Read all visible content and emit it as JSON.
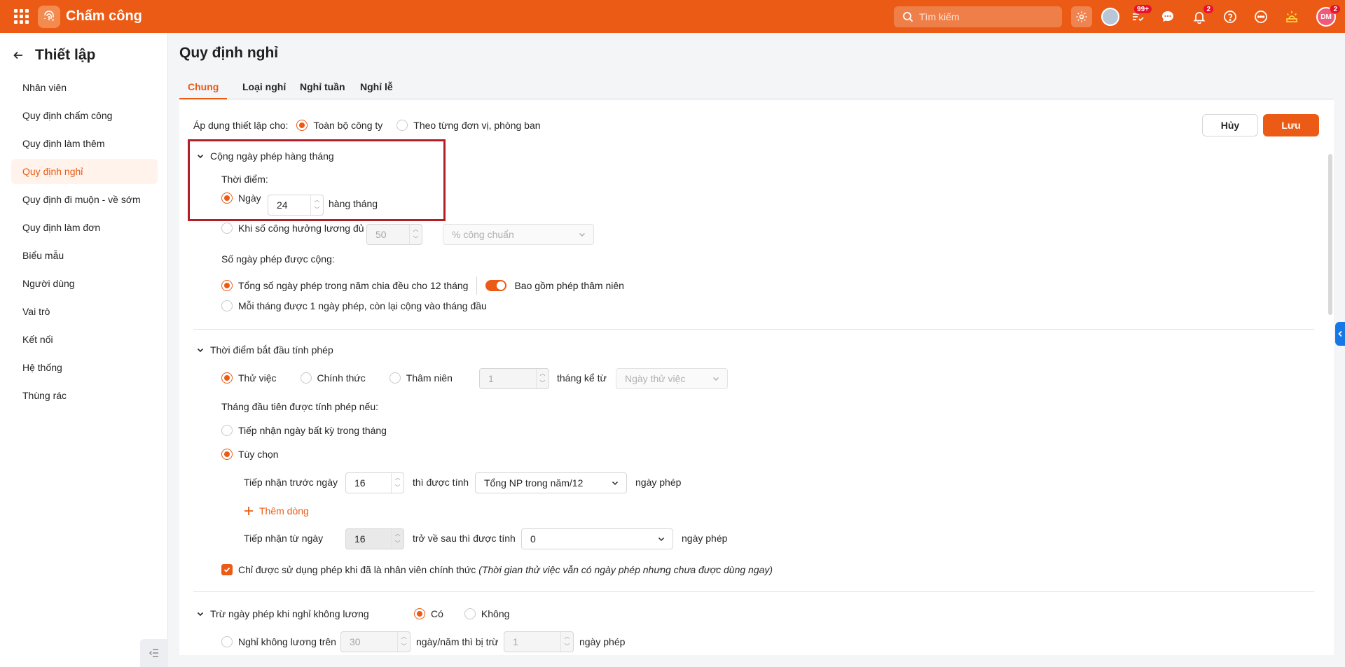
{
  "app": {
    "title": "Chấm công"
  },
  "topbar": {
    "search_placeholder": "Tìm kiếm",
    "icons": [
      "apps-grid-icon",
      "gear-icon",
      "avatar-icon",
      "task-icon",
      "chat-icon",
      "bell-icon",
      "help-icon",
      "more-icon",
      "sun-icon",
      "user-avatar"
    ],
    "task_badge": "99+",
    "bell_badge": "2",
    "user_initials": "DM",
    "user_badge": "2"
  },
  "sidebar": {
    "title": "Thiết lập",
    "items": [
      {
        "label": "Nhân viên"
      },
      {
        "label": "Quy định chấm công"
      },
      {
        "label": "Quy định làm thêm"
      },
      {
        "label": "Quy định nghỉ",
        "active": true
      },
      {
        "label": "Quy định đi muộn - về sớm"
      },
      {
        "label": "Quy định làm đơn"
      },
      {
        "label": "Biểu mẫu"
      },
      {
        "label": "Người dùng"
      },
      {
        "label": "Vai trò"
      },
      {
        "label": "Kết nối"
      },
      {
        "label": "Hệ thống"
      },
      {
        "label": "Thùng rác"
      }
    ]
  },
  "page": {
    "title": "Quy định nghỉ",
    "tabs": [
      {
        "label": "Chung",
        "active": true
      },
      {
        "label": "Loại nghỉ"
      },
      {
        "label": "Nghỉ tuần"
      },
      {
        "label": "Nghỉ lễ"
      }
    ]
  },
  "apply": {
    "label": "Áp dụng thiết lập cho:",
    "opt_company": "Toàn bộ công ty",
    "opt_units": "Theo từng đơn vị, phòng ban",
    "selected": "opt_company"
  },
  "actions": {
    "cancel": "Hủy",
    "save": "Lưu"
  },
  "monthly": {
    "title": "Cộng ngày phép hàng tháng",
    "time_label": "Thời điểm:",
    "day_label": "Ngày",
    "day_value": "24",
    "day_suffix": "hàng tháng",
    "when_label": "Khi số công hưởng lương đủ",
    "when_value": "50",
    "when_unit": "% công chuẩn",
    "count_label": "Số ngày phép được cộng:",
    "count_opt1": "Tổng số ngày phép trong năm chia đều cho 12 tháng",
    "seniority_toggle": "Bao gồm phép thâm niên",
    "count_opt2": "Mỗi tháng được 1 ngày phép, còn lại cộng vào tháng đầu"
  },
  "start": {
    "title": "Thời điểm bắt đầu tính phép",
    "opt_probation": "Thử việc",
    "opt_official": "Chính thức",
    "opt_seniority": "Thâm niên",
    "months_value": "1",
    "months_label": "tháng kể từ",
    "from_placeholder": "Ngày thử việc",
    "first_month_label": "Tháng đầu tiên được tính phép nếu:",
    "opt_any_day": "Tiếp nhận ngày bất kỳ trong tháng",
    "opt_custom": "Tùy chọn",
    "before_label": "Tiếp nhận trước ngày",
    "before_value": "16",
    "then_label": "thì được tính",
    "formula_value": "Tổng NP trong năm/12",
    "days_unit": "ngày phép",
    "add_line": "Thêm dòng",
    "from_label": "Tiếp nhận từ ngày",
    "from_value": "16",
    "after_label": "trở về sau thì được tính",
    "after_select": "0",
    "days_unit2": "ngày phép",
    "official_only": "Chỉ được sử dụng phép khi đã là nhân viên chính thức",
    "official_note": "(Thời gian thử việc vẫn có ngày phép nhưng chưa được dùng ngay)"
  },
  "deduct": {
    "title": "Trừ ngày phép khi nghỉ không lương",
    "opt_yes": "Có",
    "opt_no": "Không",
    "over_label": "Nghỉ không lương trên",
    "over_value": "30",
    "per_year_label": "ngày/năm thì bị trừ",
    "minus_value": "1",
    "days_unit": "ngày phép"
  },
  "colors": {
    "brand": "#eb5b16",
    "highlight": "#b41e28",
    "badge": "#e8112d"
  }
}
